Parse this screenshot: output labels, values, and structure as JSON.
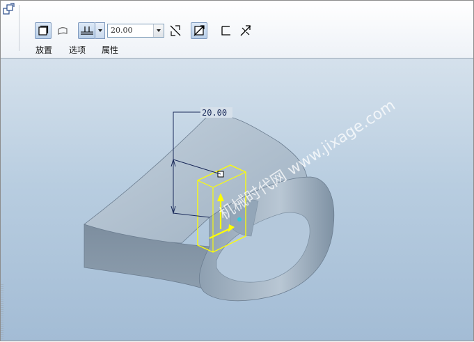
{
  "dashboard": {
    "depth_value": "20.00",
    "tabs": [
      {
        "label": "放置"
      },
      {
        "label": "选项"
      },
      {
        "label": "属性"
      }
    ]
  },
  "viewport": {
    "dimension_label": "20.00",
    "watermark": "机械时代网 www.jixage.com"
  },
  "colors": {
    "viewport_top": "#d5e1ec",
    "viewport_bottom": "#a3bcd5",
    "part_surface": "#a9b8c6",
    "preview_highlight": "#ffff00",
    "dimension_line": "#1a2a5a"
  }
}
